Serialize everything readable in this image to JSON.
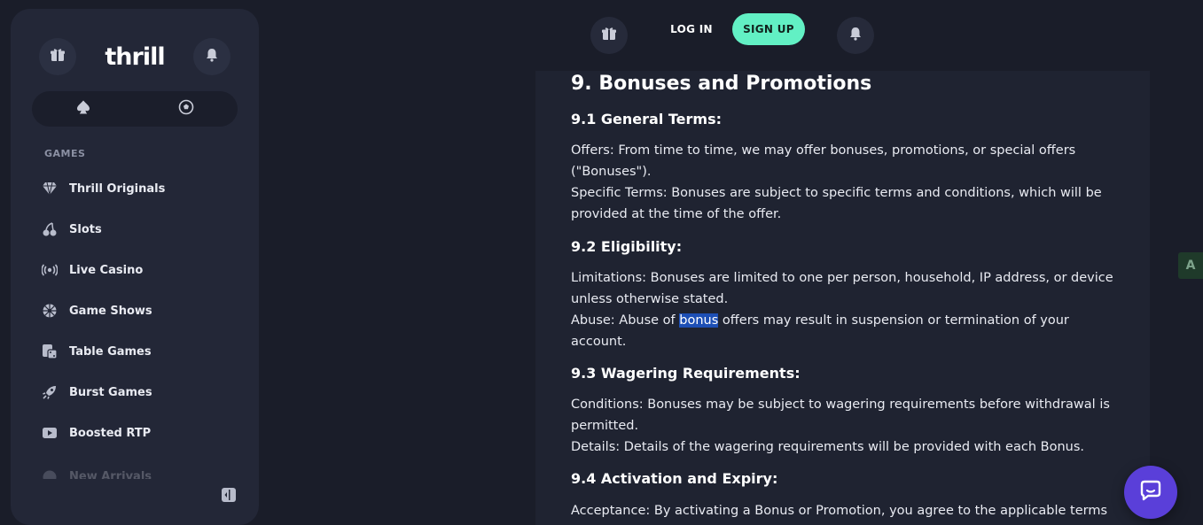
{
  "sidebar": {
    "logo": "thrill",
    "section_label": "GAMES",
    "items": [
      {
        "label": "Thrill Originals",
        "icon": "diamond-icon"
      },
      {
        "label": "Slots",
        "icon": "cherries-icon"
      },
      {
        "label": "Live Casino",
        "icon": "live-broadcast-icon"
      },
      {
        "label": "Game Shows",
        "icon": "wheel-icon"
      },
      {
        "label": "Table Games",
        "icon": "dice-card-icon"
      },
      {
        "label": "Burst Games",
        "icon": "rocket-icon"
      },
      {
        "label": "Boosted RTP",
        "icon": "boost-icon"
      },
      {
        "label": "New Arrivals",
        "icon": "new-icon"
      }
    ]
  },
  "header": {
    "login_label": "LOG IN",
    "signup_label": "SIGN UP"
  },
  "doc": {
    "title": "9. Bonuses and Promotions",
    "s1": {
      "heading": "9.1 General Terms:",
      "line1": "Offers: From time to time, we may offer bonuses, promotions, or special offers (\"Bonuses\").",
      "line2": "Specific Terms: Bonuses are subject to specific terms and conditions, which will be provided at the time of the offer."
    },
    "s2": {
      "heading": "9.2 Eligibility:",
      "line1": "Limitations: Bonuses are limited to one per person, household, IP address, or device unless otherwise stated.",
      "line2_pre": "Abuse: Abuse of ",
      "line2_hl": "bonus",
      "line2_post": " offers may result in suspension or termination of your account."
    },
    "s3": {
      "heading": "9.3 Wagering Requirements:",
      "line1": "Conditions: Bonuses may be subject to wagering requirements before withdrawal is permitted.",
      "line2": "Details: Details of the wagering requirements will be provided with each Bonus."
    },
    "s4": {
      "heading": "9.4 Activation and Expiry:",
      "line1": "Acceptance: By activating a Bonus or Promotion, you agree to the applicable terms"
    }
  },
  "translate_glyph": "A",
  "colors": {
    "background": "#1a1d29",
    "sidebar": "#232737",
    "accent_signup": "#62f0c4",
    "chat": "#5a3fd9",
    "highlight": "#1d4fb5"
  }
}
